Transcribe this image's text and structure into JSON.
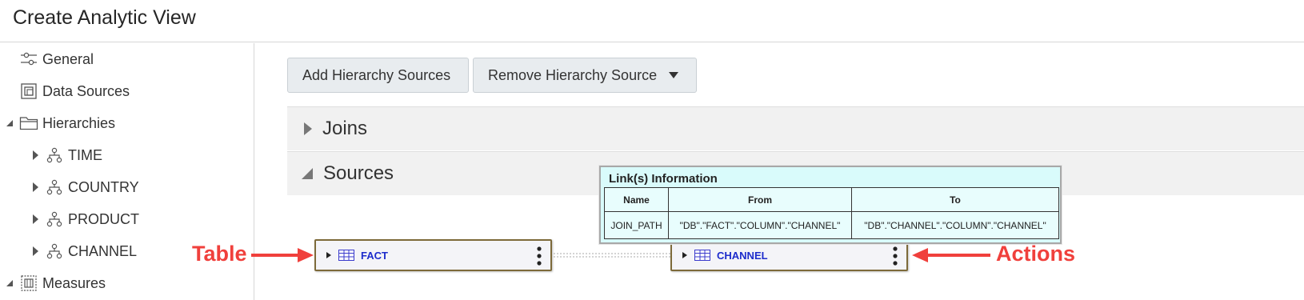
{
  "header": {
    "title": "Create Analytic View"
  },
  "sidebar": {
    "items": [
      {
        "label": "General",
        "icon": "settings-sliders-icon"
      },
      {
        "label": "Data Sources",
        "icon": "data-sources-icon"
      },
      {
        "label": "Hierarchies",
        "icon": "folder-icon",
        "expanded": true
      },
      {
        "label": "TIME",
        "icon": "hierarchy-icon"
      },
      {
        "label": "COUNTRY",
        "icon": "hierarchy-icon"
      },
      {
        "label": "PRODUCT",
        "icon": "hierarchy-icon"
      },
      {
        "label": "CHANNEL",
        "icon": "hierarchy-icon"
      },
      {
        "label": "Measures",
        "icon": "measures-icon",
        "expanded": true
      }
    ]
  },
  "toolbar": {
    "add_label": "Add Hierarchy Sources",
    "remove_label": "Remove Hierarchy Source"
  },
  "sections": {
    "joins_label": "Joins",
    "sources_label": "Sources"
  },
  "diagram": {
    "tables": [
      {
        "name": "FACT"
      },
      {
        "name": "CHANNEL"
      }
    ],
    "annotations": {
      "table": "Table",
      "actions": "Actions"
    },
    "link_info": {
      "title": "Link(s) Information",
      "headers": [
        "Name",
        "From",
        "To"
      ],
      "rows": [
        [
          "JOIN_PATH",
          "\"DB\".\"FACT\".\"COLUMN\".\"CHANNEL\"",
          "\"DB\".\"CHANNEL\".\"COLUMN\".\"CHANNEL\""
        ]
      ]
    }
  },
  "colors": {
    "annotation": "#f0403c",
    "table_name": "#1d2ccc",
    "tooltip_bg": "#d9fbfb",
    "node_border": "#7d6a3a"
  }
}
